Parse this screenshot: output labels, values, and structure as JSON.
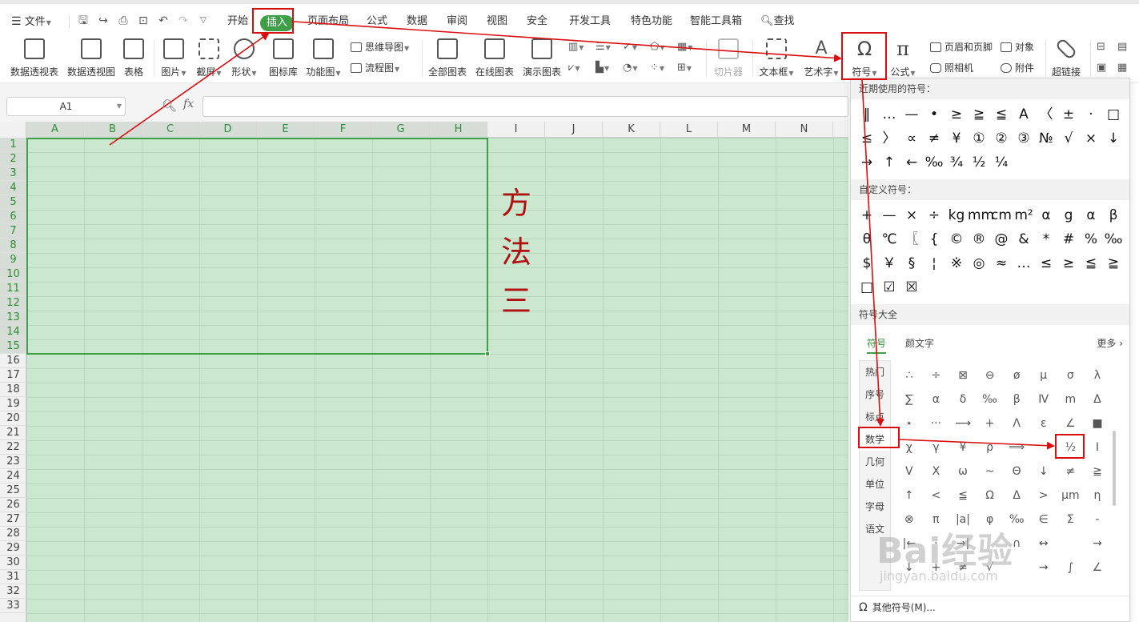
{
  "menubar": {
    "file": "文件",
    "tabs": [
      "开始",
      "插入",
      "页面布局",
      "公式",
      "数据",
      "审阅",
      "视图",
      "安全",
      "开发工具",
      "特色功能",
      "智能工具箱"
    ],
    "active_tab": "插入",
    "search": "查找"
  },
  "ribbon": {
    "pivot_table": "数据透视表",
    "pivot_chart": "数据透视图",
    "table": "表格",
    "picture": "图片",
    "screenshot": "截屏",
    "shapes": "形状",
    "icon_lib": "图标库",
    "function_chart": "功能图",
    "mindmap": "思维导图",
    "flowchart": "流程图",
    "all_charts": "全部图表",
    "online_charts": "在线图表",
    "demo_charts": "演示图表",
    "slicer": "切片器",
    "textbox": "文本框",
    "wordart": "艺术字",
    "symbol": "符号",
    "formula": "公式",
    "header_footer": "页眉和页脚",
    "object": "对象",
    "camera": "照相机",
    "attachment": "附件",
    "hyperlink": "超链接"
  },
  "formula_bar": {
    "cell_ref": "A1",
    "fx": "fx",
    "value": ""
  },
  "sheet": {
    "columns": [
      "A",
      "B",
      "C",
      "D",
      "E",
      "F",
      "G",
      "H",
      "I",
      "J",
      "K",
      "L",
      "M",
      "N"
    ],
    "rows": [
      "1",
      "2",
      "3",
      "4",
      "5",
      "6",
      "7",
      "8",
      "9",
      "10",
      "11",
      "12",
      "13",
      "14",
      "15",
      "16",
      "17",
      "18",
      "19",
      "20",
      "21",
      "22",
      "23",
      "24",
      "25",
      "26",
      "27",
      "28",
      "29",
      "30",
      "31",
      "32",
      "33"
    ],
    "title_chars": [
      "方",
      "法",
      "三"
    ]
  },
  "symbol_panel": {
    "recent_title": "近期使用的符号：",
    "recent": [
      "‖",
      "…",
      "—",
      "•",
      "≥",
      "≧",
      "≦",
      "A",
      "〈",
      "±",
      "·",
      "□",
      "≤",
      "〉",
      "∝",
      "≠",
      "¥",
      "①",
      "②",
      "③",
      "№",
      "√",
      "×",
      "↓",
      "→",
      "↑",
      "←",
      "‰",
      "¾",
      "½",
      "¼"
    ],
    "custom_title": "自定义符号：",
    "custom": [
      "+",
      "—",
      "×",
      "÷",
      "kg",
      "mm",
      "cm",
      "m²",
      "α",
      "g",
      "α",
      "β",
      "θ",
      "℃",
      "〖",
      "{",
      "©",
      "®",
      "@",
      "&",
      "*",
      "#",
      "%",
      "‰",
      "$",
      "￥",
      "§",
      "¦",
      "※",
      "◎",
      "≈",
      "…",
      "≤",
      "≥",
      "≦",
      "≧",
      "□",
      "☑",
      "☒"
    ],
    "all_title": "符号大全",
    "tab_symbols": "符号",
    "tab_kaomoji": "颜文字",
    "more": "更多",
    "categories": [
      "热门",
      "序号",
      "标点",
      "数学",
      "几何",
      "单位",
      "字母",
      "语文"
    ],
    "active_category": "数学",
    "math_symbols": [
      "∴",
      "÷",
      "⊠",
      "⊖",
      "ø",
      "μ",
      "σ",
      "λ",
      "∑",
      "α",
      "δ",
      "‰",
      "β",
      "Ⅳ",
      "m",
      "Δ",
      "⋆",
      "···",
      "⟶",
      "+",
      "Λ",
      "ε",
      "∠",
      "■",
      "χ",
      "γ",
      "¥",
      "ρ",
      "⟹",
      "",
      "½",
      "Ⅰ",
      "V",
      "X",
      "ω",
      "~",
      "Θ",
      "↓",
      "≠",
      "≧",
      "↑",
      "<",
      "≦",
      "Ω",
      "Δ",
      ">",
      "μm",
      "η",
      "⊗",
      "π",
      "|a|",
      "φ",
      "‰",
      "∈",
      "Σ",
      "-",
      "|←",
      "·",
      "→|",
      "",
      "∩",
      "↔",
      "",
      "→",
      "↓",
      "+",
      "≠",
      "√",
      "",
      "→",
      "∫",
      "∠"
    ],
    "highlighted_symbol": "½",
    "other_symbols": "其他符号(M)..."
  },
  "watermark": {
    "brand": "Bai经验",
    "url": "jingyan.baidu.com"
  },
  "annotation_color": "#d90f0f",
  "accent_color": "#3f9f49"
}
